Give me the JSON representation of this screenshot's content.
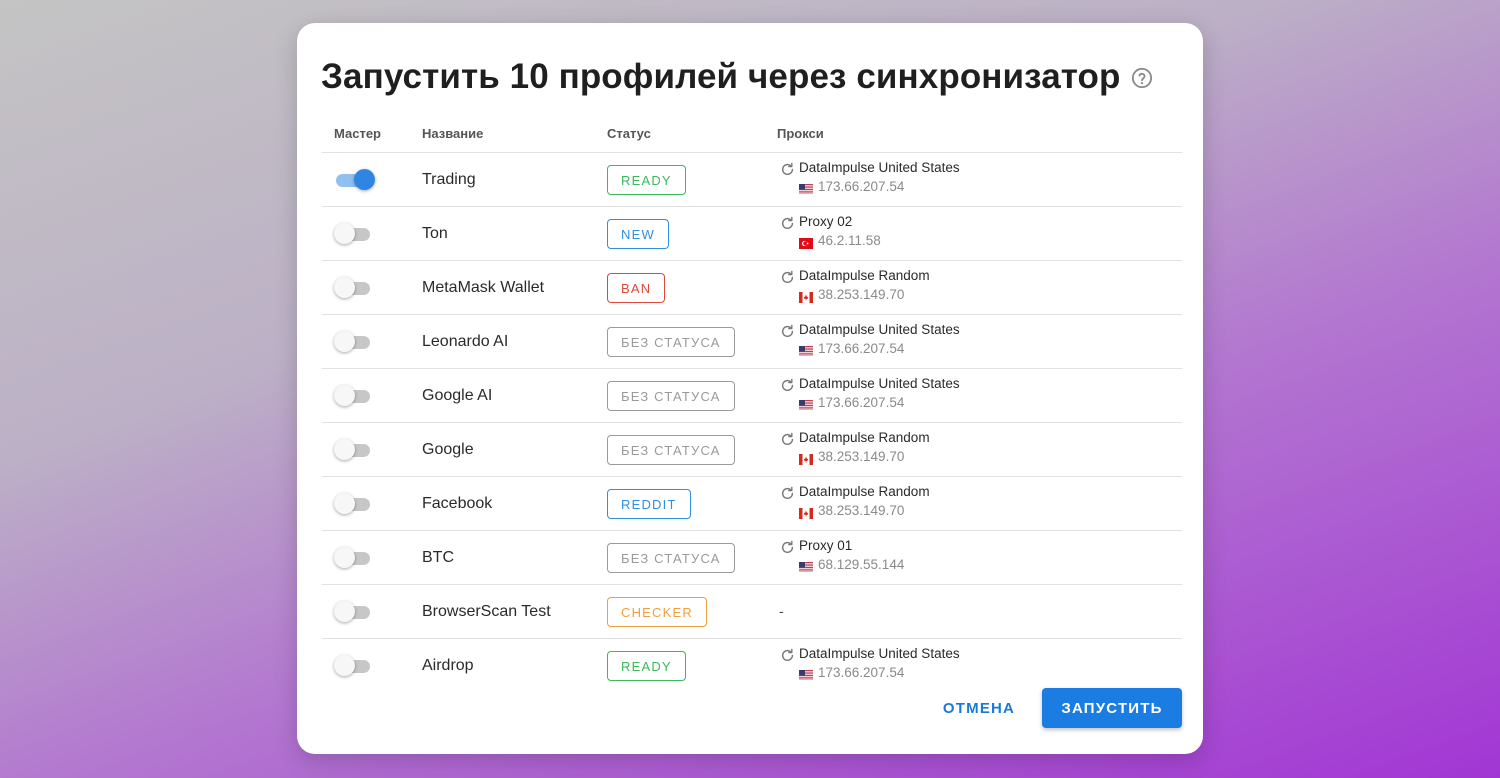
{
  "dialog": {
    "title": "Запустить 10 профилей через синхронизатор",
    "help_icon": "question-circle-icon",
    "columns": {
      "master": "Мастер",
      "name": "Название",
      "status": "Статус",
      "proxy": "Прокси"
    },
    "rows": [
      {
        "master_on": true,
        "name": "Trading",
        "status": "READY",
        "status_color": "#3cb95c",
        "proxy_name": "DataImpulse United States",
        "flag": "us",
        "ip": "173.66.207.54"
      },
      {
        "master_on": false,
        "name": "Ton",
        "status": "NEW",
        "status_color": "#2f8fe0",
        "proxy_name": "Proxy 02",
        "flag": "tr",
        "ip": "46.2.11.58"
      },
      {
        "master_on": false,
        "name": "MetaMask Wallet",
        "status": "BAN",
        "status_color": "#e0483a",
        "proxy_name": "DataImpulse Random",
        "flag": "ca",
        "ip": "38.253.149.70"
      },
      {
        "master_on": false,
        "name": "Leonardo AI",
        "status": "БЕЗ СТАТУСА",
        "status_color": "#9a9a9a",
        "proxy_name": "DataImpulse United States",
        "flag": "us",
        "ip": "173.66.207.54"
      },
      {
        "master_on": false,
        "name": "Google AI",
        "status": "БЕЗ СТАТУСА",
        "status_color": "#9a9a9a",
        "proxy_name": "DataImpulse United States",
        "flag": "us",
        "ip": "173.66.207.54"
      },
      {
        "master_on": false,
        "name": "Google",
        "status": "БЕЗ СТАТУСА",
        "status_color": "#9a9a9a",
        "proxy_name": "DataImpulse Random",
        "flag": "ca",
        "ip": "38.253.149.70"
      },
      {
        "master_on": false,
        "name": "Facebook",
        "status": "REDDIT",
        "status_color": "#2f8fe0",
        "proxy_name": "DataImpulse Random",
        "flag": "ca",
        "ip": "38.253.149.70"
      },
      {
        "master_on": false,
        "name": "BTC",
        "status": "БЕЗ СТАТУСА",
        "status_color": "#9a9a9a",
        "proxy_name": "Proxy 01",
        "flag": "us",
        "ip": "68.129.55.144"
      },
      {
        "master_on": false,
        "name": "BrowserScan Test",
        "status": "CHECKER",
        "status_color": "#f0a040",
        "proxy_name": null,
        "no_proxy": "-"
      },
      {
        "master_on": false,
        "name": "Airdrop",
        "status": "READY",
        "status_color": "#3cb95c",
        "proxy_name": "DataImpulse United States",
        "flag": "us",
        "ip": "173.66.207.54"
      }
    ],
    "buttons": {
      "cancel": "ОТМЕНА",
      "run": "ЗАПУСТИТЬ"
    },
    "colors": {
      "accent": "#1b7de2",
      "toggle_on": "#2f86e2"
    }
  }
}
